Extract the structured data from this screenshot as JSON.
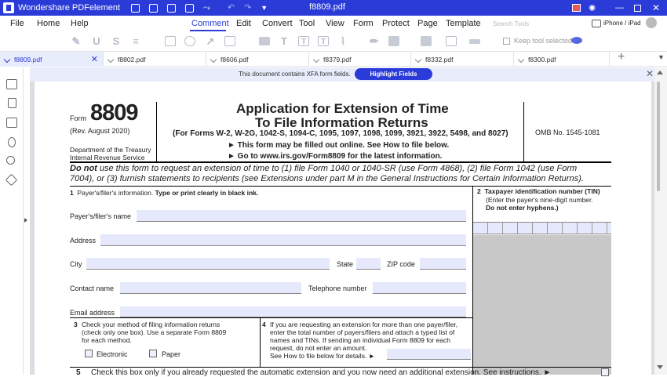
{
  "app": {
    "name": "Wondershare PDFelement",
    "document_title": "f8809.pdf"
  },
  "menu": {
    "items": [
      "File",
      "Home",
      "Help",
      "Comment",
      "Edit",
      "Convert",
      "Tool",
      "View",
      "Form",
      "Protect",
      "Page",
      "Template"
    ],
    "active": "Comment",
    "search_placeholder": "Search Tools",
    "device_label": "iPhone / iPad"
  },
  "toolbar": {
    "keep_tool_selected": "Keep tool selected"
  },
  "tabs": [
    {
      "label": "f8809.pdf",
      "active": true
    },
    {
      "label": "f8802.pdf",
      "active": false
    },
    {
      "label": "f8606.pdf",
      "active": false
    },
    {
      "label": "f8379.pdf",
      "active": false
    },
    {
      "label": "f8332.pdf",
      "active": false
    },
    {
      "label": "f8300.pdf",
      "active": false
    }
  ],
  "xfa_bar": {
    "message": "This document contains XFA form fields.",
    "button": "Highlight Fields"
  },
  "form": {
    "form_label": "Form",
    "form_number": "8809",
    "revision": "(Rev. August 2020)",
    "department": "Department of the Treasury",
    "service": "Internal Revenue Service",
    "title_line1": "Application for Extension of Time",
    "title_line2": "To File Information Returns",
    "subtitle": "(For Forms W-2, W-2G, 1042-S, 1094-C, 1095, 1097, 1098, 1099, 3921, 3922, 5498, and 8027)",
    "online_line": "► This form may be filled out online. See How to file below.",
    "url_line": "► Go to www.irs.gov/Form8809 for the latest information.",
    "omb": "OMB No. 1545-1081",
    "warning_bold": "Do not",
    "warning_line1": " use this form to request an extension of time to (1) file Form 1040 or 1040-SR (use Form 4868), (2) file Form 1042 (use Form",
    "warning_line2": "7004), or (3) furnish statements to recipients (see Extensions under part M in the General Instructions for Certain Information Returns).",
    "line1_num": "1",
    "line1_text": "Payer's/filer's information.",
    "line1_bold": "Type or print clearly in black ink.",
    "payer_name_label": "Payer's/filer's name",
    "address_label": "Address",
    "city_label": "City",
    "state_label": "State",
    "zip_label": "ZIP code",
    "contact_label": "Contact name",
    "telephone_label": "Telephone number",
    "email_label": "Email address",
    "line2_num": "2",
    "line2_title": "Taxpayer identification number (TIN)",
    "line2_text": "(Enter the payer's nine-digit number.",
    "line2_bold": "Do not enter hyphens.)",
    "line3_num": "3",
    "line3_text_1": "Check your method of filing information returns",
    "line3_text_2": "(check only one box). Use a separate Form 8809",
    "line3_text_3": "for each method.",
    "electronic_label": "Electronic",
    "paper_label": "Paper",
    "line4_num": "4",
    "line4_text_1": "If you are requesting an extension for more than one payer/filer,",
    "line4_text_2": "enter the total number of payers/filers and attach a typed list of",
    "line4_text_3": "names and TINs. If sending an individual Form 8809 for each",
    "line4_text_4": "request, do not enter an amount.",
    "line4_text_5": "See How to file below for details. ►",
    "line5_num": "5",
    "line5_text": "Check this box only if you already requested the automatic extension and you now need an additional extension. See instructions. ►"
  }
}
